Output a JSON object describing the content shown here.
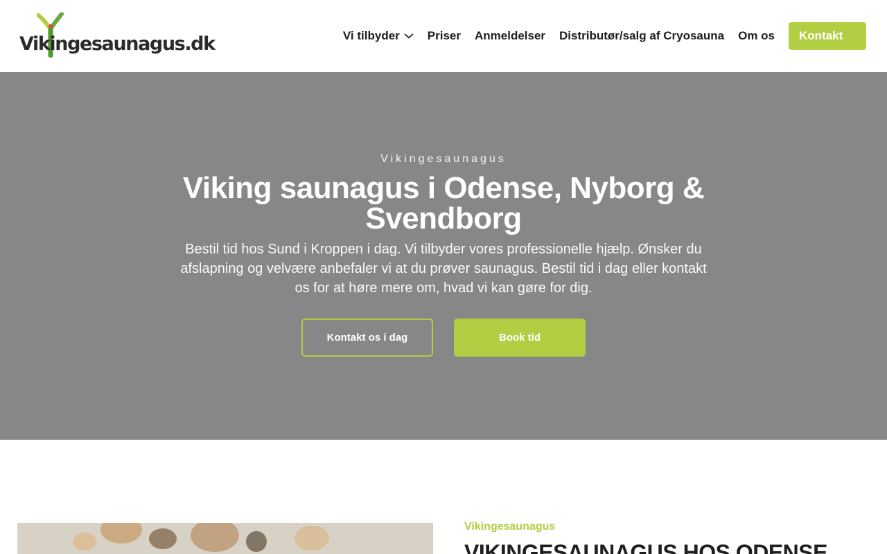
{
  "colors": {
    "accent": "#b2cf43",
    "hero_bg": "#878787",
    "text_dark": "#1f1f1f"
  },
  "header": {
    "logo_text": "Vikingesaunagus.dk",
    "nav": [
      {
        "label": "Vi tilbyder",
        "icon": "chevron-down-icon"
      },
      {
        "label": "Priser"
      },
      {
        "label": "Anmeldelser"
      },
      {
        "label": "Distributør/salg af Cryosauna"
      },
      {
        "label": "Om os"
      }
    ],
    "cta_label": "Kontakt"
  },
  "hero": {
    "eyebrow": "Vikingesaunagus",
    "title": "Viking saunagus i Odense, Nyborg & Svendborg",
    "text": "Bestil tid hos Sund i Kroppen i dag. Vi tilbyder vores professionelle hjælp. Ønsker du afslapning og velvære anbefaler vi at du prøver saunagus. Bestil tid i dag eller kontakt os for at høre mere om, hvad vi kan gøre for dig.",
    "button_secondary": "Kontakt os i dag",
    "button_primary": "Book tid"
  },
  "section": {
    "eyebrow": "Vikingesaunagus",
    "title": "VIKINGESAUNAGUS HOS ODENSE"
  }
}
